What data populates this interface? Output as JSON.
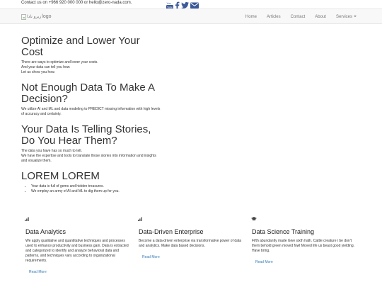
{
  "topbar": {
    "contact": "Contact us on +966 920 000 000 or hello@zero-nada.com.",
    "social": [
      {
        "icon": "youtube-icon",
        "label": "You Tube",
        "color": "#3b5998"
      },
      {
        "icon": "facebook-icon",
        "label": "f",
        "color": "#3b5998"
      },
      {
        "icon": "twitter-icon",
        "label": "twitter",
        "color": "#3b5998"
      },
      {
        "icon": "email-icon",
        "label": "email",
        "color": "#3b5998"
      }
    ]
  },
  "navbar": {
    "logo_alt": "زيرو نادا",
    "logo_text": "logo",
    "links": [
      "Home",
      "Articles",
      "Contact",
      "About",
      "Services"
    ]
  },
  "sections": [
    {
      "heading": "Optimize and Lower Your Cost",
      "lines": [
        "There are ways to optimize and lower your costs.",
        "And your data can tell you how.",
        "Let us show you how."
      ]
    },
    {
      "heading": "Not Enough Data To Make A Decision?",
      "lines": [
        "We utilize AI and ML and data modeling to PREDICT missing information with high levels of accuracy and certainty."
      ]
    },
    {
      "heading": "Your Data Is Telling Stories, Do You Hear Them?",
      "lines": [
        "The data you have has so much to tell.",
        "We have the expertise and tools to translate those stories into information and insights and visualize them."
      ]
    },
    {
      "heading": "LOREM LOREM",
      "bullets": [
        "Your data is full of gems and hidden treasures.",
        "We employ an army of AI and ML to dig them up for you."
      ]
    }
  ],
  "features": [
    {
      "icon": "bar-chart-icon",
      "title": "Data Analytics",
      "text": "We apply qualitative and quantitative techniques and processes used to enhance productivity and business gain. Data is extracted and categorized to identify and analyze behavioral data and patterns, and techniques vary according to organizational requirements.",
      "link": "Read More"
    },
    {
      "icon": "bar-chart-icon",
      "title": "Data-Driven Enterprise",
      "text": "Become a data-driven enterprise via transformative power of data and analytics. Make data based decisions.",
      "link": "Read More"
    },
    {
      "icon": "graduation-cap-icon",
      "title": "Data Science Training",
      "text": "Fifth abundantly made Give sixth hath. Cattle creature i be don't them behold green moved fowl Moved life us beast good yielding. Have bring.",
      "link": "Read More"
    }
  ]
}
